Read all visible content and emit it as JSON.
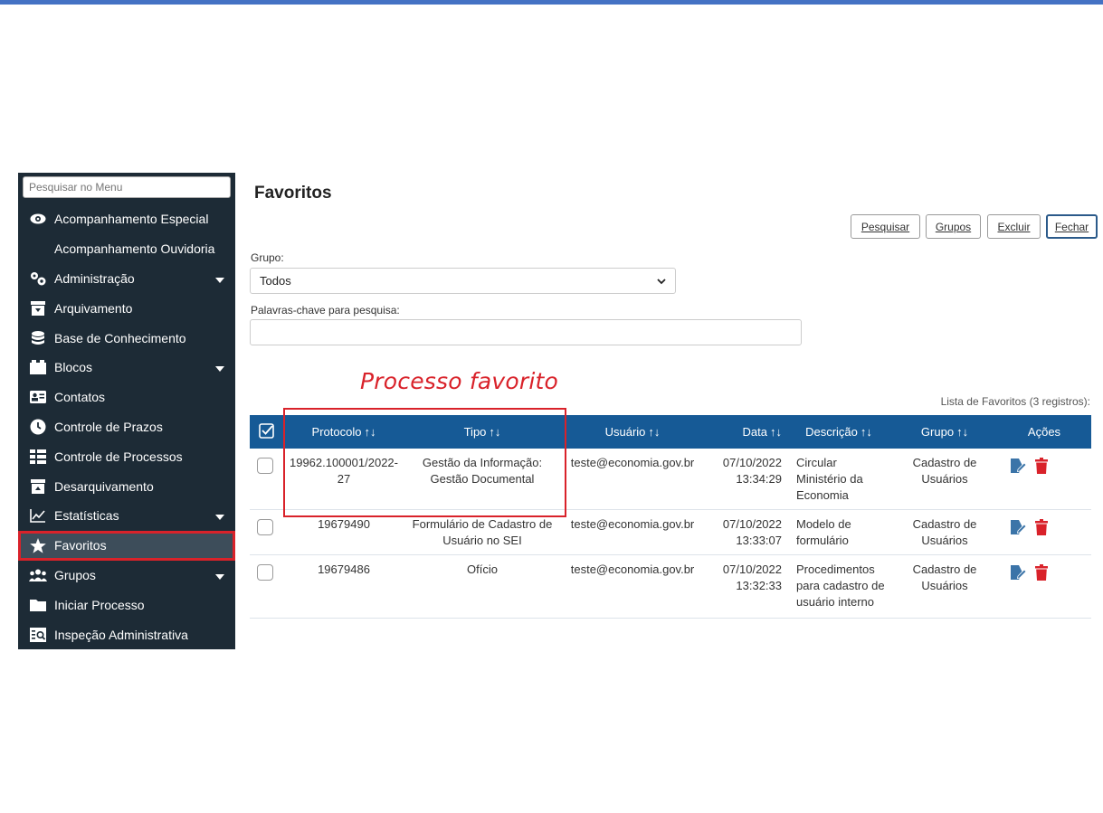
{
  "colors": {
    "sidebar_bg": "#1d2b36",
    "header_bg": "#165a96",
    "highlight": "#d9222a",
    "edit_icon": "#3b74a8",
    "delete_icon": "#d9222a"
  },
  "sidebar": {
    "search_placeholder": "Pesquisar no Menu",
    "items": [
      {
        "label": "Acompanhamento Especial",
        "icon": "eye-icon"
      },
      {
        "label": "Acompanhamento Ouvidoria",
        "icon": ""
      },
      {
        "label": "Administração",
        "icon": "gears-icon",
        "has_submenu": true
      },
      {
        "label": "Arquivamento",
        "icon": "archive-icon"
      },
      {
        "label": "Base de Conhecimento",
        "icon": "database-icon"
      },
      {
        "label": "Blocos",
        "icon": "blocks-icon",
        "has_submenu": true
      },
      {
        "label": "Contatos",
        "icon": "contact-card-icon"
      },
      {
        "label": "Controle de Prazos",
        "icon": "clock-icon"
      },
      {
        "label": "Controle de Processos",
        "icon": "list-icon"
      },
      {
        "label": "Desarquivamento",
        "icon": "unarchive-icon"
      },
      {
        "label": "Estatísticas",
        "icon": "chart-line-icon",
        "has_submenu": true
      },
      {
        "label": "Favoritos",
        "icon": "star-icon",
        "selected": true
      },
      {
        "label": "Grupos",
        "icon": "users-icon",
        "has_submenu": true
      },
      {
        "label": "Iniciar Processo",
        "icon": "folder-icon"
      },
      {
        "label": "Inspeção Administrativa",
        "icon": "inspection-icon"
      }
    ]
  },
  "main": {
    "title": "Favoritos",
    "buttons": {
      "pesquisar": "Pesquisar",
      "grupos": "Grupos",
      "excluir": "Excluir",
      "fechar": "Fechar"
    },
    "grupo_label": "Grupo:",
    "grupo_value": "Todos",
    "keywords_label": "Palavras-chave para pesquisa:",
    "keywords_value": "",
    "annotation": "Processo favorito",
    "list_caption": "Lista de Favoritos (3 registros):",
    "table": {
      "headers": [
        "Protocolo",
        "Tipo",
        "Usuário",
        "Data",
        "Descrição",
        "Grupo",
        "Ações"
      ],
      "rows": [
        {
          "protocolo": "19962.100001/2022-27",
          "tipo": "Gestão da Informação: Gestão Documental",
          "usuario": "teste@economia.gov.br",
          "data_date": "07/10/2022",
          "data_time": "13:34:29",
          "descricao": "Circular Ministério da Economia",
          "grupo": "Cadastro de Usuários"
        },
        {
          "protocolo": "19679490",
          "tipo": "Formulário de Cadastro de Usuário no SEI",
          "usuario": "teste@economia.gov.br",
          "data_date": "07/10/2022",
          "data_time": "13:33:07",
          "descricao": "Modelo de formulário",
          "grupo": "Cadastro de Usuários"
        },
        {
          "protocolo": "19679486",
          "tipo": "Ofício",
          "usuario": "teste@economia.gov.br",
          "data_date": "07/10/2022",
          "data_time": "13:32:33",
          "descricao": "Procedimentos para cadastro de usuário interno",
          "grupo": "Cadastro de Usuários"
        }
      ]
    }
  }
}
